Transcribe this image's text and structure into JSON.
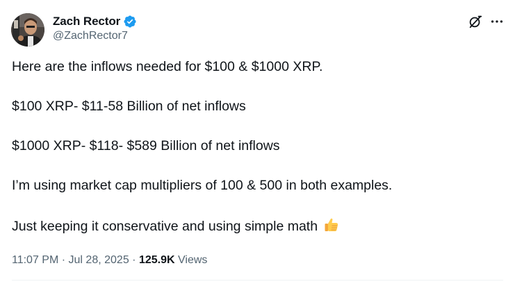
{
  "author": {
    "display_name": "Zach Rector",
    "handle": "@ZachRector7",
    "verified": true,
    "verified_color": "#1d9bf0"
  },
  "actions": {
    "grok_icon": "grok-icon",
    "more_icon": "more-icon"
  },
  "tweet": {
    "lines": [
      "Here are the inflows needed for $100 & $1000 XRP.",
      "$100 XRP- $11-58 Billion of net inflows",
      "$1000 XRP- $118- $589 Billion of net inflows",
      "I’m using market cap multipliers of 100 & 500 in both examples.",
      "Just keeping it conservative and using simple math"
    ],
    "trailing_emoji": "thumbs-up-icon"
  },
  "meta": {
    "time": "11:07 PM",
    "separator": "·",
    "date": "Jul 28, 2025",
    "views_count": "125.9K",
    "views_label": "Views"
  }
}
